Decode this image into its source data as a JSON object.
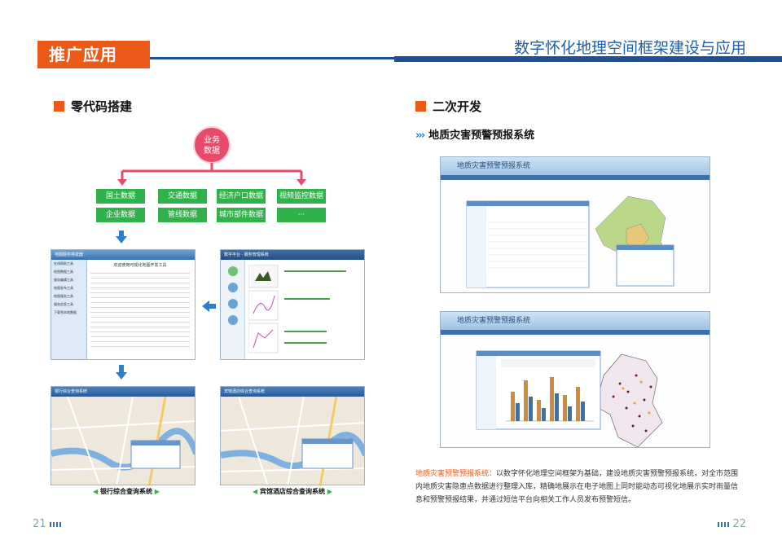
{
  "header": {
    "tab_label": "推广应用",
    "title": "数字怀化地理空间框架建设与应用"
  },
  "left": {
    "heading": "零代码搭建",
    "center_node": "业务\n数据",
    "boxes": [
      "国土数据",
      "交通数据",
      "经济户口数据",
      "视频监控数据",
      "企业数据",
      "管线数据",
      "城市部件数据",
      "···"
    ],
    "editor_title": "地图服务搭建器",
    "editor_nav": [
      "在线帮助工具",
      "地图数据工具",
      "服务编辑工具",
      "地图发布工具",
      "地图服务工具",
      "服务信息工具",
      "下载到本地数据"
    ],
    "editor_heading": "欢迎使用可视化地图开发工具",
    "designer_title": "数字平台 · 服务管理系统",
    "map_title_1": "银行综合查询系统",
    "map_title_2": "宾馆酒店综合查询系统",
    "caption_1": "银行综合查询系统",
    "caption_2": "宾馆酒店综合查询系统"
  },
  "right": {
    "heading": "二次开发",
    "subheading": "地质灾害预警预报系统",
    "app_title_1": "地质灾害预警预报系统",
    "app_title_2": "地质灾害预警预报系统",
    "desc_highlight": "地质灾害预警预报系统：",
    "desc_body": "以数字怀化地理空间框架为基础，建设地质灾害预警预报系统，对全市范围内地质灾害隐患点数据进行整理入库，精确地展示在电子地图上同时能动态可视化地展示实时雨量信息和预警预报结果，并通过短信平台向相关工作人员发布预警短信。"
  },
  "footer": {
    "page_left": "21",
    "page_right": "22"
  },
  "colors": {
    "accent_orange": "#ec5a18",
    "brand_blue": "#1f4f96",
    "box_green": "#2fb24a",
    "node_pink": "#e84a6a"
  }
}
